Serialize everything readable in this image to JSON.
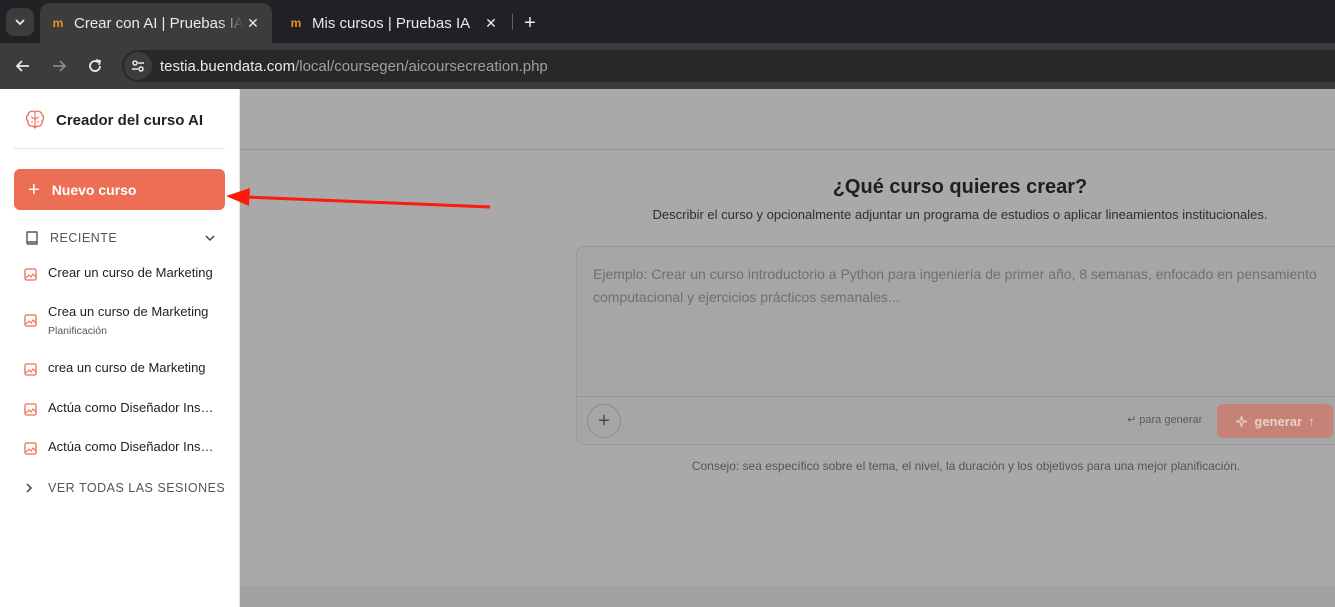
{
  "browser": {
    "tabs": [
      {
        "title": "Crear con AI | Pruebas IA",
        "favicon": "moodle-favicon",
        "active": true
      },
      {
        "title": "Mis cursos | Pruebas IA",
        "favicon": "moodle-favicon",
        "active": false
      }
    ],
    "url_host": "testia.buendata.com",
    "url_path": "/local/coursegen/aicoursecreation.php"
  },
  "sidebar": {
    "title": "Creador del curso AI",
    "new_course_label": "Nuevo curso",
    "recent_label": "RECIENTE",
    "sessions": [
      {
        "title": "Crear un curso de Marketing",
        "subtitle": ""
      },
      {
        "title": "Crea un curso de Marketing",
        "subtitle": "Planificación"
      },
      {
        "title": "crea un curso de Marketing",
        "subtitle": ""
      },
      {
        "title": "Actúa como Diseñador Instruccional",
        "subtitle": ""
      },
      {
        "title": "Actúa como Diseñador Instruccional",
        "subtitle": ""
      }
    ],
    "see_all_label": "VER TODAS LAS SESIONES"
  },
  "main": {
    "title": "¿Qué curso quieres crear?",
    "subtitle": "Describir el curso y opcionalmente adjuntar un programa de estudios o aplicar lineamientos institucionales.",
    "prompt_placeholder": "Ejemplo: Crear un curso introductorio a Python para ingeniería de primer año, 8 semanas, enfocado en pensamiento computacional y ejercicios prácticos semanales...",
    "enter_hint": "↵ para generar",
    "generate_label": "generar",
    "tip": "Consejo: sea específico sobre el tema, el nivel, la duración y los objetivos para una mejor planificación."
  },
  "colors": {
    "accent": "#ec6f55",
    "overlay": "#a9a9a9",
    "annotation_arrow": "#ff1a0a"
  }
}
